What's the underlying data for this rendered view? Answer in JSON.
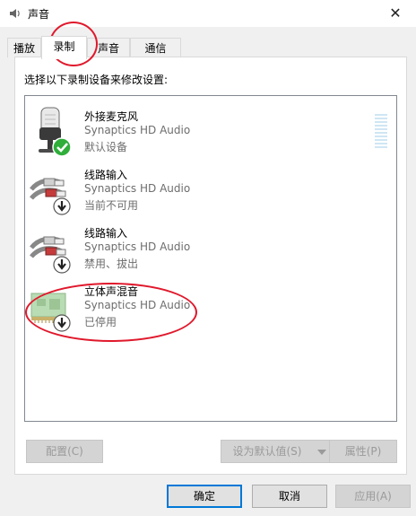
{
  "window": {
    "title": "声音",
    "close_glyph": "✕"
  },
  "tabs": [
    {
      "label": "播放",
      "active": false
    },
    {
      "label": "录制",
      "active": true
    },
    {
      "label": "声音",
      "active": false
    },
    {
      "label": "通信",
      "active": false
    }
  ],
  "instruction": "选择以下录制设备来修改设置:",
  "devices": [
    {
      "name": "外接麦克风",
      "driver": "Synaptics HD Audio",
      "status": "默认设备",
      "icon": "microphone-icon",
      "badge": "default-check-icon"
    },
    {
      "name": "线路输入",
      "driver": "Synaptics HD Audio",
      "status": "当前不可用",
      "icon": "line-in-cable-icon",
      "badge": "down-arrow-icon"
    },
    {
      "name": "线路输入",
      "driver": "Synaptics HD Audio",
      "status": "禁用、拔出",
      "icon": "line-in-cable-icon",
      "badge": "down-arrow-icon"
    },
    {
      "name": "立体声混音",
      "driver": "Synaptics HD Audio",
      "status": "已停用",
      "icon": "sound-card-icon",
      "badge": "down-arrow-icon"
    }
  ],
  "panel_buttons": {
    "configure": "配置(C)",
    "set_default": "设为默认值(S)",
    "properties": "属性(P)"
  },
  "dialog_buttons": {
    "ok": "确定",
    "cancel": "取消",
    "apply": "应用(A)"
  },
  "colors": {
    "annotation": "#e0192c",
    "focus_blue": "#0078d7",
    "check_green": "#2fae3a"
  }
}
